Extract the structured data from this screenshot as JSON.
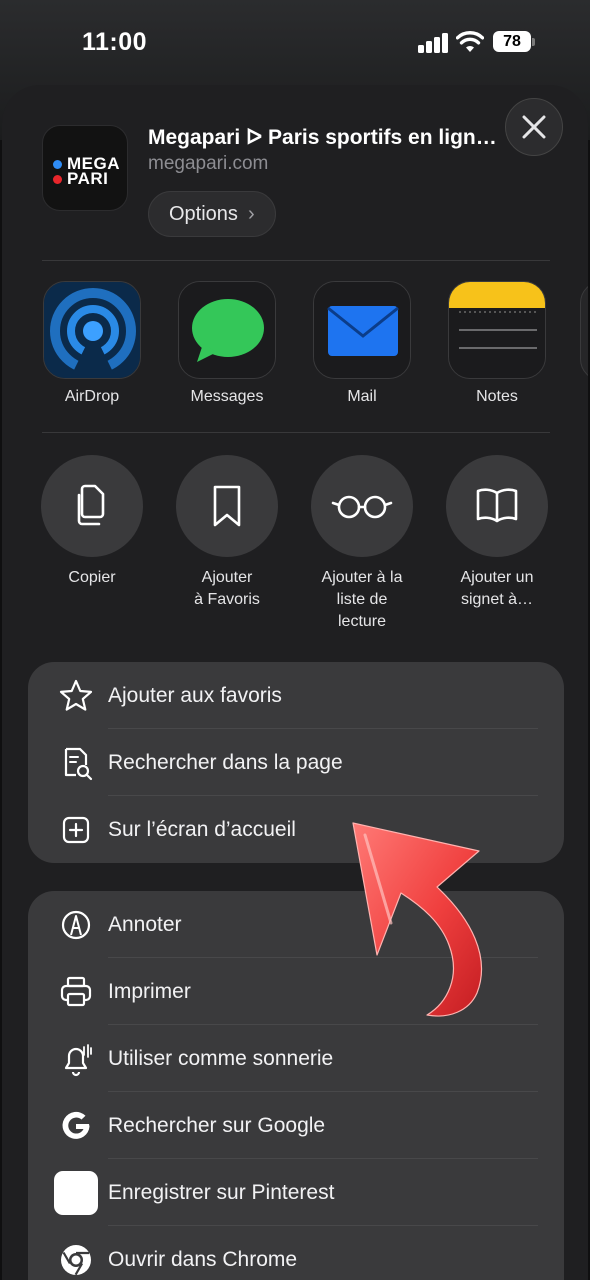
{
  "status_bar": {
    "time": "11:00",
    "battery": "78"
  },
  "share_header": {
    "app_logo_text": [
      "MEGA",
      "PARI"
    ],
    "title": "Megapari ᐅ Paris sportifs en lign…",
    "url": "megapari.com",
    "options_label": "Options",
    "close_icon": "xmark-icon"
  },
  "apps": [
    {
      "label": "AirDrop",
      "icon": "airdrop-icon"
    },
    {
      "label": "Messages",
      "icon": "messages-icon"
    },
    {
      "label": "Mail",
      "icon": "mail-icon"
    },
    {
      "label": "Notes",
      "icon": "notes-icon"
    }
  ],
  "actions": [
    {
      "label": "Copier",
      "icon": "copy-icon"
    },
    {
      "label": "Ajouter\nà Favoris",
      "icon": "bookmark-icon"
    },
    {
      "label": "Ajouter à la\nliste de\nlecture",
      "icon": "glasses-icon"
    },
    {
      "label": "Ajouter un\nsignet à…",
      "icon": "book-icon"
    }
  ],
  "menu_group_1": [
    {
      "label": "Ajouter aux favoris",
      "icon": "star-icon"
    },
    {
      "label": "Rechercher dans la page",
      "icon": "find-in-page-icon"
    },
    {
      "label": "Sur l’écran d’accueil",
      "icon": "plus-square-icon"
    }
  ],
  "menu_group_2": [
    {
      "label": "Annoter",
      "icon": "markup-icon"
    },
    {
      "label": "Imprimer",
      "icon": "printer-icon"
    },
    {
      "label": "Utiliser comme sonnerie",
      "icon": "bell-icon"
    },
    {
      "label": "Rechercher sur Google",
      "icon": "google-icon"
    },
    {
      "label": "Enregistrer sur Pinterest",
      "icon": "pinterest-icon"
    },
    {
      "label": "Ouvrir dans Chrome",
      "icon": "chrome-icon"
    }
  ],
  "colors": {
    "sheet_bg": "#1f1f21",
    "group_bg": "#3a3a3c",
    "arrow_red": "#f0403f",
    "messages_green": "#34c759",
    "mail_blue": "#1e74f0",
    "notes_yellow": "#f7c21a",
    "logo_blue": "#2f8cf5",
    "logo_red": "#e8262b"
  }
}
